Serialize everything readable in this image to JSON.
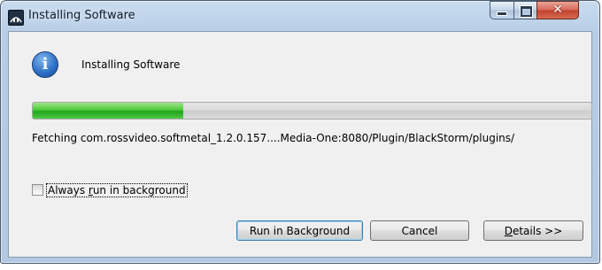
{
  "window": {
    "title": "Installing Software",
    "icon": "app-icon",
    "controls": {
      "minimize": "minimize-icon",
      "maximize": "maximize-icon",
      "close": "close-icon"
    }
  },
  "header": {
    "icon": "info-icon",
    "title": "Installing Software"
  },
  "progress": {
    "fraction": 0.27,
    "fill_color": "#35b82b"
  },
  "status_text": "Fetching com.rossvideo.softmetal_1.2.0.157....Media-One:8080/Plugin/BlackStorm/plugins/",
  "checkbox": {
    "label_before": "Always ",
    "label_mnemonic": "r",
    "label_after": "un in background",
    "checked": false
  },
  "buttons": {
    "run_in_background": "Run in Background",
    "cancel": "Cancel",
    "details_mnemonic": "D",
    "details_rest": "etails >>"
  }
}
